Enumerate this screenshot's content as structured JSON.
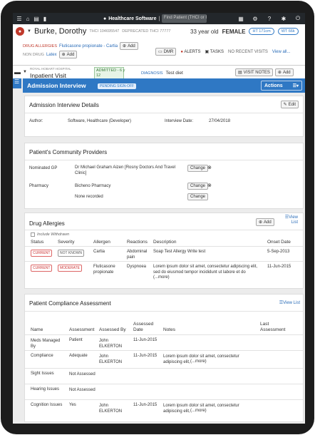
{
  "topbar": {
    "app_title": "Healthcare Software",
    "find_placeholder": "Find Patient (THCI or I"
  },
  "patient": {
    "name": "Burke, Dorothy",
    "thci": "THCI 104695547",
    "deprecated": "DEPRECATED THCI 77777",
    "age": "33 year old",
    "sex": "FEMALE",
    "ht": "HT 171cm",
    "wt": "WT 66k",
    "drug_allergies_label": "DRUG ALLERGIES",
    "drug_allergies_value": "Fluticasone propionate - Cartia",
    "add_label": "Add",
    "non_drug_label": "NON DRUG",
    "non_drug_value": "Latex",
    "dmr_label": "DMR",
    "alerts_label": "ALERTS",
    "tasks_label": "TASKS",
    "recent_visits": "NO RECENT VISITS",
    "view_all": "View all..."
  },
  "visit": {
    "hospital": "ROYAL HOBART HOSPITAL",
    "type": "Inpatient Visit",
    "admitted_label": "ADMITTED - 6 y",
    "admitted_days": "12",
    "diagnosis_label": "DIAGNOSIS",
    "diagnosis_value": "Test diet",
    "visit_notes_label": "VISIT NOTES",
    "add_label": "Add"
  },
  "header": {
    "title": "Admission Interview",
    "pending": "PENDING SIGN-OFF",
    "actions": "Actions"
  },
  "details": {
    "title": "Admission Interview Details",
    "edit": "Edit",
    "author_label": "Author:",
    "author_value": "Software, Healthcare (Developer)",
    "date_label": "Interview Date:",
    "date_value": "27/04/2018"
  },
  "providers": {
    "title": "Patient's Community Providers",
    "gp_label": "Nominated GP",
    "gp_value": "Dr Michael Graham Aizen [Rosny Doctors And Travel Clinic]",
    "pharmacy_label": "Pharmacy",
    "pharmacy_value": "Bicheno Pharmacy",
    "none_value": "None recorded",
    "change_label": "Change"
  },
  "allergies": {
    "title": "Drug Allergies",
    "add": "Add",
    "view_list": "View List",
    "include_withdrawn": "Include Withdrawn",
    "headers": [
      "Status",
      "Severity",
      "Allergen",
      "Reactions",
      "Description",
      "Onset Date"
    ],
    "rows": [
      {
        "status": "CURRENT",
        "severity": "NOT KNOWN",
        "allergen": "Cartia",
        "reaction": "Abdominal pain",
        "description": "Soap Test Allergy Write test",
        "more": "",
        "onset": "5-Sep-2013"
      },
      {
        "status": "CURRENT",
        "severity": "MODERATE",
        "allergen": "Fluticasone propionate",
        "reaction": "Dyspnoea",
        "description": "Lorem ipsum dolor sit amet, consectetur adipiscing elit, sed do eiusmod tempor incididunt ut labore et do",
        "more": "(...more)",
        "onset": "11-Jun-2015"
      }
    ]
  },
  "compliance": {
    "title": "Patient Compliance Assessment",
    "view_list": "View List",
    "headers": {
      "name": "Name",
      "assessment": "Assessment",
      "assessed_by": "Assessed By",
      "assessed_date": "Assessed Date",
      "notes": "Notes",
      "last_assessment": "Last Assessment"
    },
    "rows": [
      {
        "name": "Meds Managed By",
        "assessment": "Patient",
        "by": "John ELKERTON",
        "date": "11-Jun-2015",
        "notes": "",
        "more": ""
      },
      {
        "name": "Compliance",
        "assessment": "Adequate",
        "by": "John ELKERTON",
        "date": "11-Jun-2015",
        "notes": "Lorem ipsum dolor sit amet, consectetur adipiscing elit,",
        "more": "(...more)"
      },
      {
        "name": "Sight Issues",
        "assessment": "Not Assessed",
        "by": "",
        "date": "",
        "notes": "",
        "more": ""
      },
      {
        "name": "Hearing Issues",
        "assessment": "Not Assessed",
        "by": "",
        "date": "",
        "notes": "",
        "more": ""
      },
      {
        "name": "Cognition Issues",
        "assessment": "Yes",
        "by": "John ELKERTON",
        "date": "11-Jun-2015",
        "notes": "Lorem ipsum dolor sit amet, consectetur adipiscing elit,",
        "more": "(...more)"
      }
    ]
  }
}
